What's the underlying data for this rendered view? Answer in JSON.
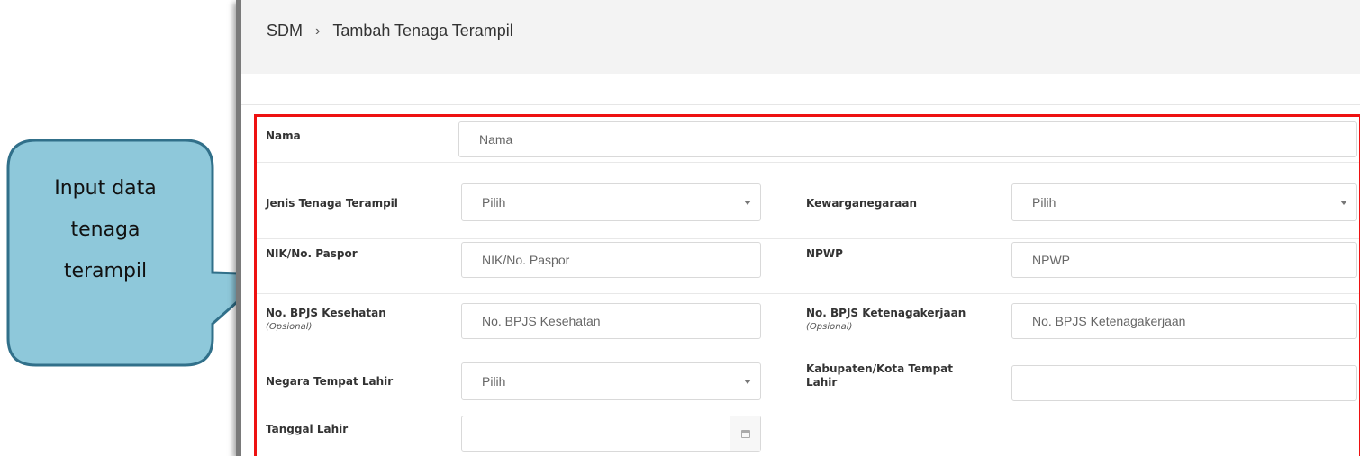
{
  "callout": {
    "text": "Input data tenaga terampil"
  },
  "breadcrumb": {
    "root": "SDM",
    "separator": "›",
    "current": "Tambah Tenaga Terampil"
  },
  "form": {
    "nama": {
      "label": "Nama",
      "placeholder": "Nama"
    },
    "jenis": {
      "label": "Jenis Tenaga Terampil",
      "value": "Pilih"
    },
    "kewarganegaraan": {
      "label": "Kewarganegaraan",
      "value": "Pilih"
    },
    "nik": {
      "label": "NIK/No. Paspor",
      "placeholder": "NIK/No. Paspor"
    },
    "npwp": {
      "label": "NPWP",
      "placeholder": "NPWP"
    },
    "bpjs_kes": {
      "label": "No. BPJS Kesehatan",
      "note": "(Opsional)",
      "placeholder": "No. BPJS Kesehatan"
    },
    "bpjs_tk": {
      "label": "No. BPJS Ketenagakerjaan",
      "note": "(Opsional)",
      "placeholder": "No. BPJS Ketenagakerjaan"
    },
    "negara_lahir": {
      "label": "Negara Tempat Lahir",
      "value": "Pilih"
    },
    "kota_lahir": {
      "label": "Kabupaten/Kota Tempat Lahir",
      "placeholder": ""
    },
    "tanggal_lahir": {
      "label": "Tanggal Lahir",
      "placeholder": ""
    }
  },
  "icons": {
    "calendar": "calendar-icon",
    "dropdown": "chevron-down-icon"
  },
  "colors": {
    "highlight_border": "#ee1111",
    "callout_fill": "#8ec8da",
    "callout_stroke": "#31708a"
  }
}
